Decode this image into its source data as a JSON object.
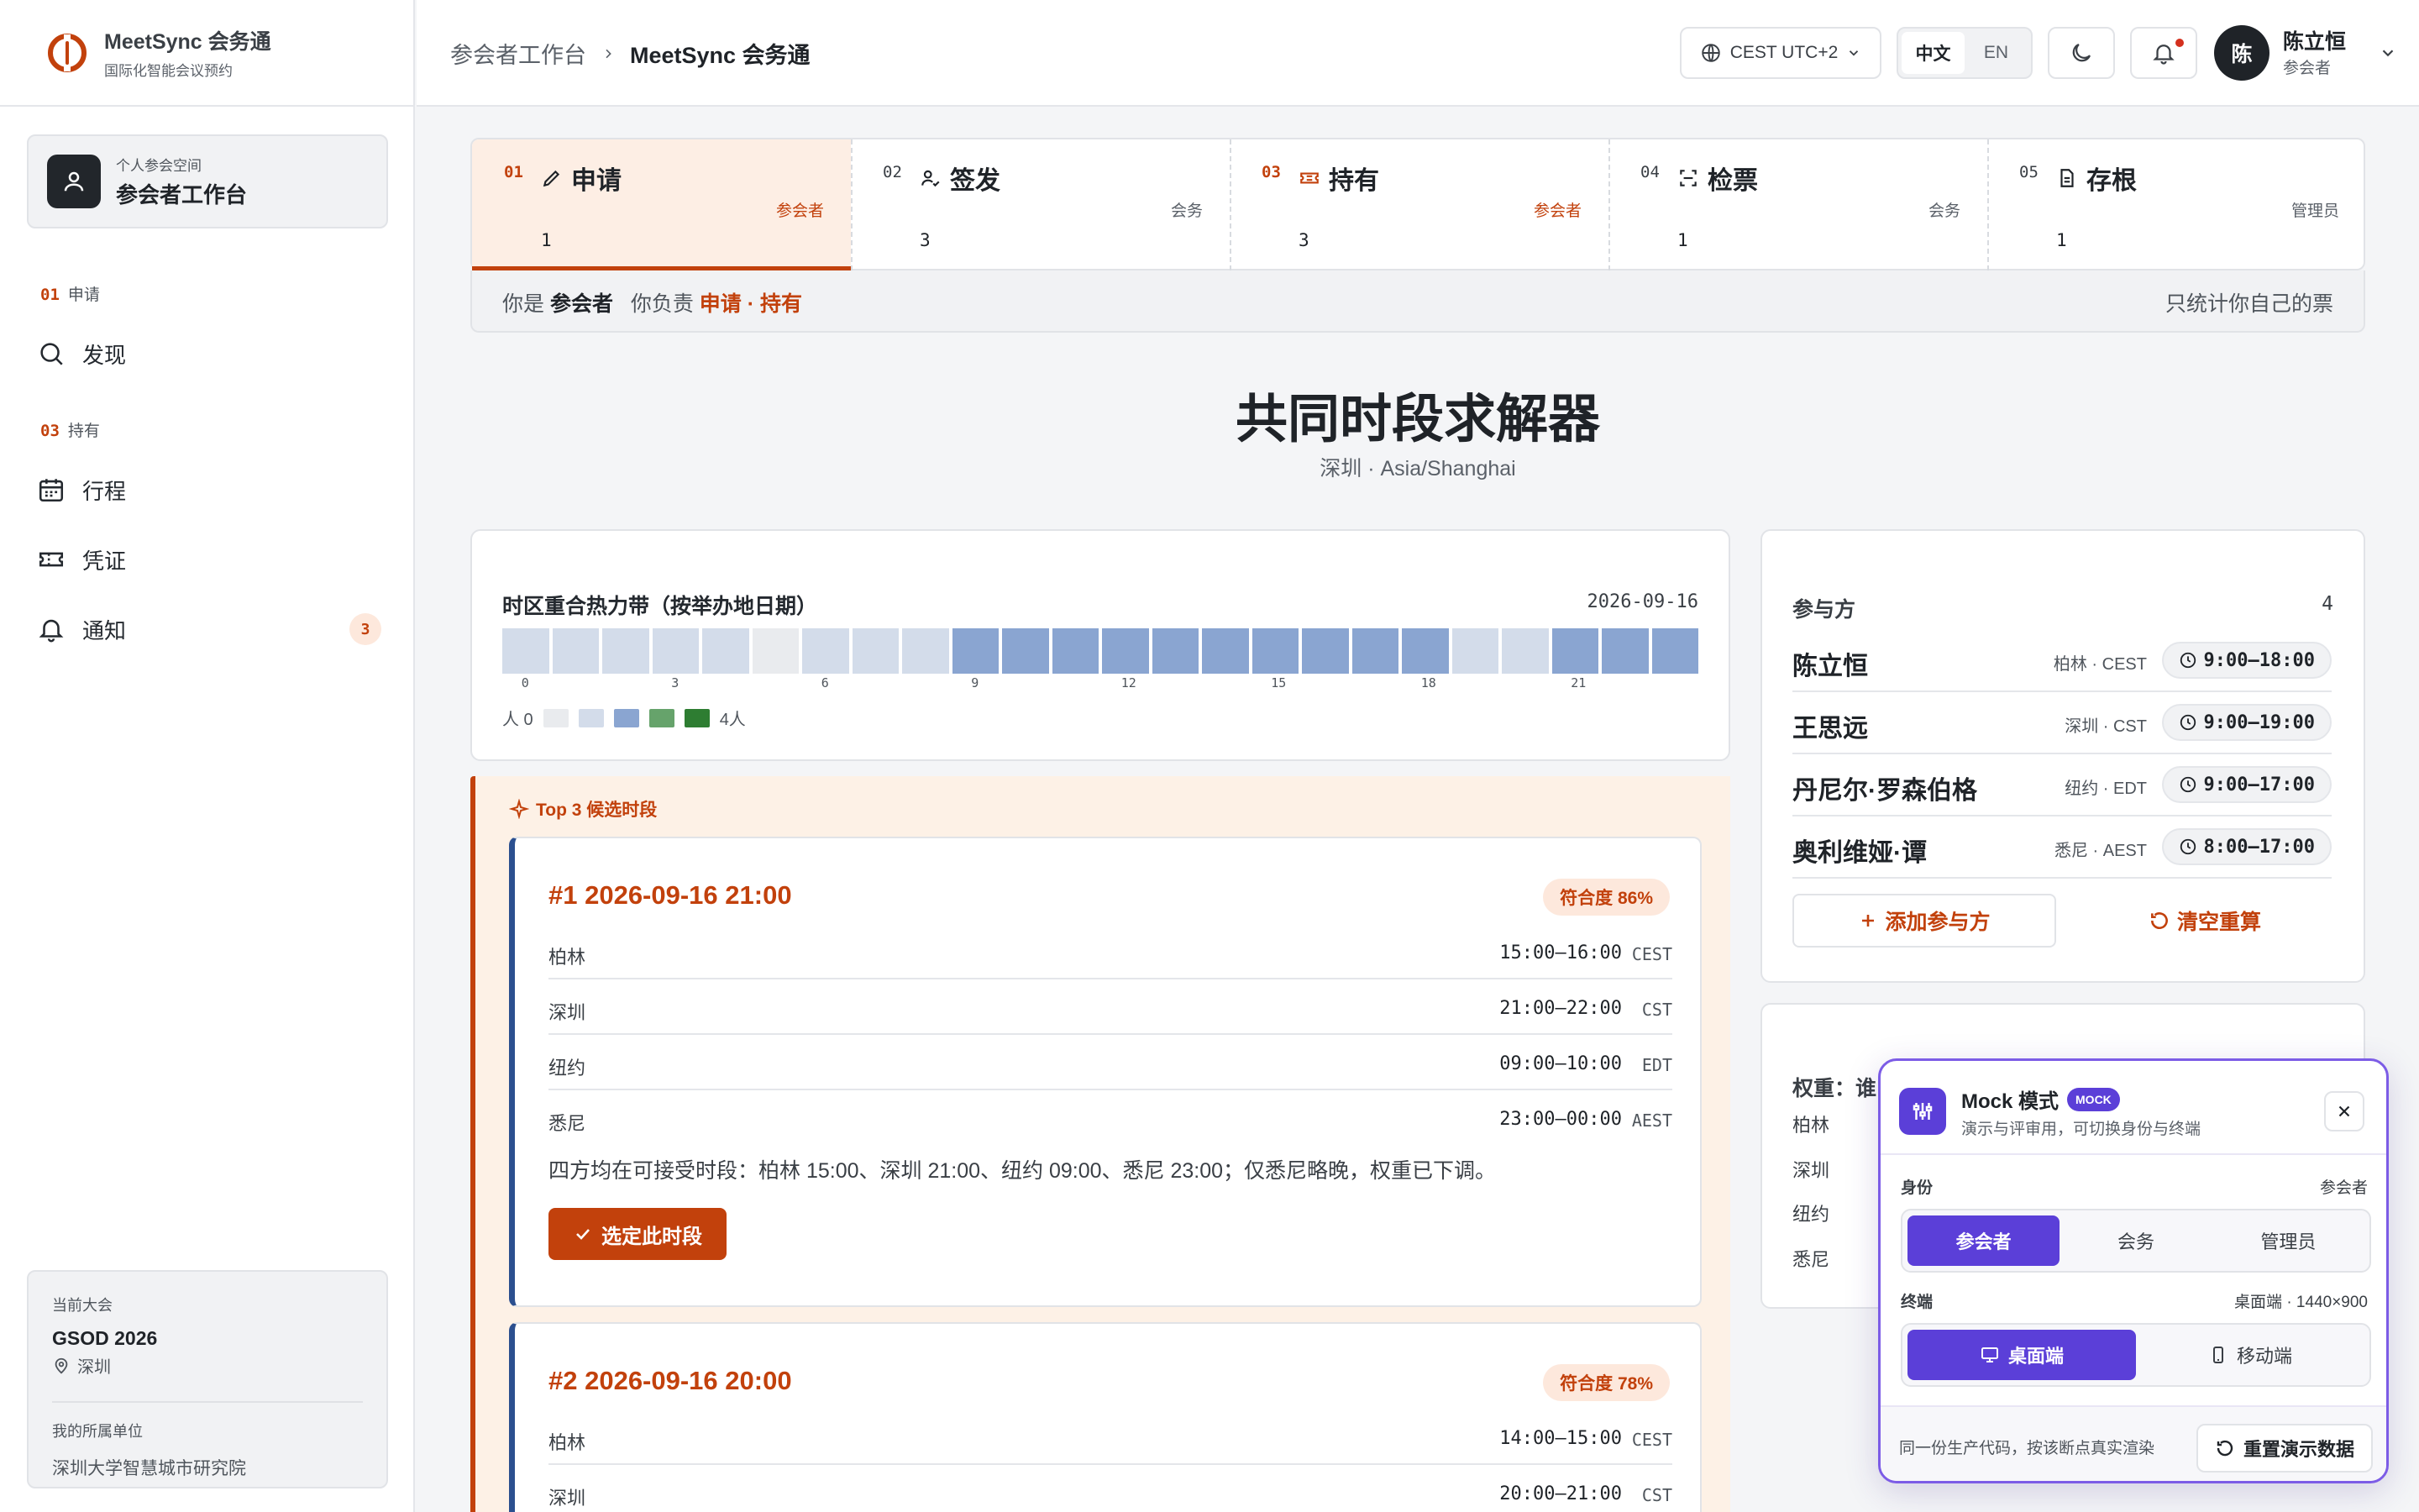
{
  "brand": {
    "name": "MeetSync 会务通",
    "subtitle": "国际化智能会议预约"
  },
  "sidebar": {
    "workspace": {
      "small": "个人参会空间",
      "title": "参会者工作台"
    },
    "sections": [
      {
        "num": "01",
        "label": "申请"
      },
      {
        "num": "03",
        "label": "持有"
      }
    ],
    "items": [
      {
        "label": "发现",
        "icon": "search-icon"
      },
      {
        "label": "行程",
        "icon": "calendar-icon"
      },
      {
        "label": "凭证",
        "icon": "ticket-icon"
      },
      {
        "label": "通知",
        "icon": "bell-icon",
        "badge": "3"
      }
    ],
    "event": {
      "heading": "当前大会",
      "name": "GSOD 2026",
      "city": "深圳",
      "org_heading": "我的所属单位",
      "org": "深圳大学智慧城市研究院"
    }
  },
  "header": {
    "breadcrumb": [
      "参会者工作台",
      "MeetSync 会务通"
    ],
    "timezone": "CEST UTC+2",
    "languages": [
      "中文",
      "EN"
    ],
    "active_language": "中文",
    "user": {
      "initial": "陈",
      "name": "陈立恒",
      "role": "参会者"
    }
  },
  "steps": [
    {
      "num": "01",
      "title": "申请",
      "role": "参会者",
      "count": "1",
      "active": true,
      "highlight": true,
      "icon": "pencil-icon"
    },
    {
      "num": "02",
      "title": "签发",
      "role": "会务",
      "count": "3",
      "active": false,
      "highlight": false,
      "icon": "user-check-icon"
    },
    {
      "num": "03",
      "title": "持有",
      "role": "参会者",
      "count": "3",
      "active": false,
      "highlight": true,
      "icon": "ticket-icon"
    },
    {
      "num": "04",
      "title": "检票",
      "role": "会务",
      "count": "1",
      "active": false,
      "highlight": false,
      "icon": "scan-icon"
    },
    {
      "num": "05",
      "title": "存根",
      "role": "管理员",
      "count": "1",
      "active": false,
      "highlight": false,
      "icon": "file-icon"
    }
  ],
  "role_bar": {
    "you_are": "你是",
    "role": "参会者",
    "responsible": "你负责",
    "duties": "申请 · 持有",
    "note": "只统计你自己的票"
  },
  "page": {
    "title": "共同时段求解器",
    "subtitle": "深圳 · Asia/Shanghai"
  },
  "heatmap": {
    "title": "时区重合热力带（按举办地日期）",
    "date": "2026-09-16",
    "levels": [
      1,
      1,
      1,
      1,
      1,
      0,
      1,
      1,
      1,
      2,
      2,
      2,
      2,
      2,
      2,
      2,
      2,
      2,
      2,
      1,
      1,
      2,
      2,
      2
    ],
    "ticks": [
      "0",
      "3",
      "6",
      "9",
      "12",
      "15",
      "18",
      "21"
    ],
    "legend_start": "人 0",
    "legend_end": "4人",
    "colors": [
      "#e9ebee",
      "#d3dcea",
      "#8aa5d1",
      "#66a36b",
      "#2e7d32"
    ]
  },
  "top3": {
    "label": "Top 3 候选时段",
    "slots": [
      {
        "title": "#1 2026-09-16 21:00",
        "fit": "符合度 86%",
        "rows": [
          {
            "city": "柏林",
            "time": "15:00–16:00",
            "tz": "CEST"
          },
          {
            "city": "深圳",
            "time": "21:00–22:00",
            "tz": "CST"
          },
          {
            "city": "纽约",
            "time": "09:00–10:00",
            "tz": "EDT"
          },
          {
            "city": "悉尼",
            "time": "23:00–00:00",
            "tz": "AEST"
          }
        ],
        "desc": "四方均在可接受时段：柏林 15:00、深圳 21:00、纽约 09:00、悉尼 23:00；仅悉尼略晚，权重已下调。",
        "button": "选定此时段"
      },
      {
        "title": "#2 2026-09-16 20:00",
        "fit": "符合度 78%",
        "rows": [
          {
            "city": "柏林",
            "time": "14:00–15:00",
            "tz": "CEST"
          },
          {
            "city": "深圳",
            "time": "20:00–21:00",
            "tz": "CST"
          }
        ]
      }
    ]
  },
  "participants": {
    "title": "参与方",
    "count": "4",
    "list": [
      {
        "name": "陈立恒",
        "loc": "柏林 · CEST",
        "hours": "9:00–18:00"
      },
      {
        "name": "王思远",
        "loc": "深圳 · CST",
        "hours": "9:00–19:00"
      },
      {
        "name": "丹尼尔·罗森伯格",
        "loc": "纽约 · EDT",
        "hours": "9:00–17:00"
      },
      {
        "name": "奥利维娅·谭",
        "loc": "悉尼 · AEST",
        "hours": "8:00–17:00"
      }
    ],
    "add_label": "添加参与方",
    "reset_label": "清空重算"
  },
  "weights": {
    "title": "权重：谁",
    "cities": [
      "柏林",
      "深圳",
      "纽约",
      "悉尼"
    ]
  },
  "mock": {
    "title": "Mock 模式",
    "badge": "MOCK",
    "subtitle": "演示与评审用，可切换身份与终端",
    "identity_label": "身份",
    "identity_value": "参会者",
    "identities": [
      "参会者",
      "会务",
      "管理员"
    ],
    "terminal_label": "终端",
    "terminal_value": "桌面端 · 1440×900",
    "terminals": [
      "桌面端",
      "移动端"
    ],
    "footer_text": "同一份生产代码，按该断点真实渲染",
    "reset_label": "重置演示数据"
  },
  "colors": {
    "accent": "#c2410c",
    "mock": "#5b3fd8",
    "slot_border": "#2b4f8f"
  }
}
